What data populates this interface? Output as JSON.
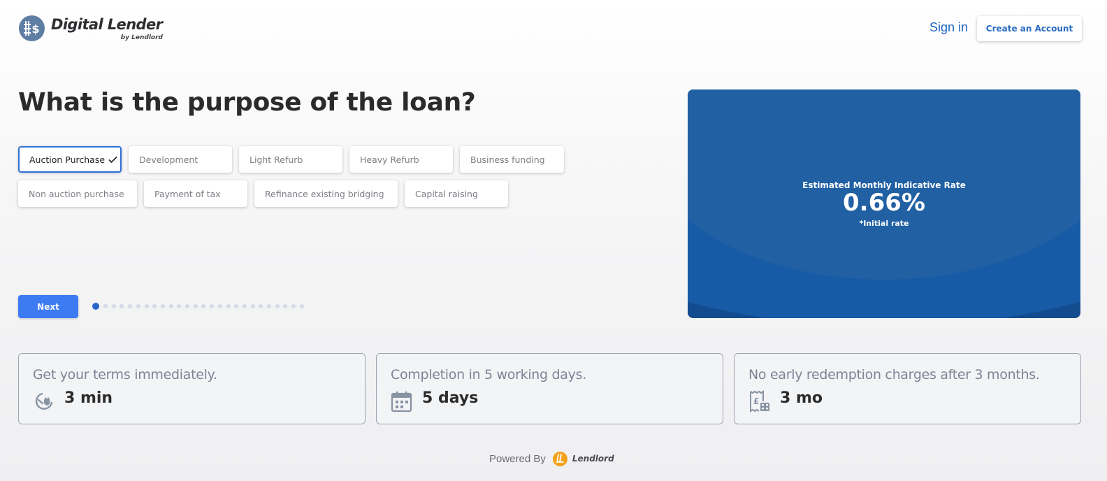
{
  "header": {
    "logo_title": "Digital Lender",
    "logo_subtitle": "by Lendlord",
    "signin_label": "Sign in",
    "create_account_label": "Create an Account"
  },
  "question": {
    "title": "What is the purpose of the loan?",
    "options": [
      {
        "label": "Auction Purchase",
        "selected": true
      },
      {
        "label": "Development",
        "selected": false
      },
      {
        "label": "Light Refurb",
        "selected": false
      },
      {
        "label": "Heavy Refurb",
        "selected": false
      },
      {
        "label": "Business funding",
        "selected": false
      },
      {
        "label": "Non auction purchase",
        "selected": false
      },
      {
        "label": "Payment of tax",
        "selected": false
      },
      {
        "label": "Refinance existing bridging",
        "selected": false
      },
      {
        "label": "Capital raising",
        "selected": false
      }
    ]
  },
  "navigation": {
    "next_label": "Next",
    "progress": {
      "current_step": 1,
      "total_steps": 26
    }
  },
  "rate_card": {
    "label": "Estimated Monthly Indicative Rate",
    "value": "0.66%",
    "note": "*Initial rate"
  },
  "features": [
    {
      "title": "Get your terms immediately.",
      "value": "3 min",
      "icon": "timer-icon"
    },
    {
      "title": "Completion in 5 working days.",
      "value": "5 days",
      "icon": "calendar-icon"
    },
    {
      "title": "No early redemption charges after 3 months.",
      "value": "3 mo",
      "icon": "receipt-pound-icon"
    }
  ],
  "footer": {
    "powered_by": "Powered By",
    "brand": "Lendlord"
  },
  "colors": {
    "primary_blue": "#3d7bf3",
    "link_blue": "#1f66c4",
    "card_blue": "#114a8b",
    "brand_orange": "#f4a11a"
  }
}
